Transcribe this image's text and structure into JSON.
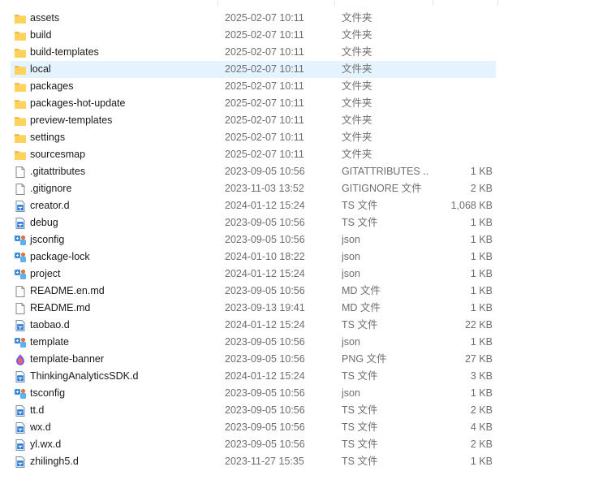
{
  "files": [
    {
      "name": "assets",
      "date": "2025-02-07 10:11",
      "type": "文件夹",
      "size": "",
      "icon": "folder-icon"
    },
    {
      "name": "build",
      "date": "2025-02-07 10:11",
      "type": "文件夹",
      "size": "",
      "icon": "folder-icon"
    },
    {
      "name": "build-templates",
      "date": "2025-02-07 10:11",
      "type": "文件夹",
      "size": "",
      "icon": "folder-icon"
    },
    {
      "name": "local",
      "date": "2025-02-07 10:11",
      "type": "文件夹",
      "size": "",
      "icon": "folder-icon",
      "selected": true
    },
    {
      "name": "packages",
      "date": "2025-02-07 10:11",
      "type": "文件夹",
      "size": "",
      "icon": "folder-icon"
    },
    {
      "name": "packages-hot-update",
      "date": "2025-02-07 10:11",
      "type": "文件夹",
      "size": "",
      "icon": "folder-icon"
    },
    {
      "name": "preview-templates",
      "date": "2025-02-07 10:11",
      "type": "文件夹",
      "size": "",
      "icon": "folder-icon"
    },
    {
      "name": "settings",
      "date": "2025-02-07 10:11",
      "type": "文件夹",
      "size": "",
      "icon": "folder-icon"
    },
    {
      "name": "sourcesmap",
      "date": "2025-02-07 10:11",
      "type": "文件夹",
      "size": "",
      "icon": "folder-icon"
    },
    {
      "name": ".gitattributes",
      "date": "2023-09-05 10:56",
      "type": "GITATTRIBUTES ...",
      "size": "1 KB",
      "icon": "blank-file-icon"
    },
    {
      "name": ".gitignore",
      "date": "2023-11-03 13:52",
      "type": "GITIGNORE 文件",
      "size": "2 KB",
      "icon": "blank-file-icon"
    },
    {
      "name": "creator.d",
      "date": "2024-01-12 15:24",
      "type": "TS 文件",
      "size": "1,068 KB",
      "icon": "ts-file-icon"
    },
    {
      "name": "debug",
      "date": "2023-09-05 10:56",
      "type": "TS 文件",
      "size": "1 KB",
      "icon": "ts-file-icon"
    },
    {
      "name": "jsconfig",
      "date": "2023-09-05 10:56",
      "type": "json",
      "size": "1 KB",
      "icon": "json-file-icon"
    },
    {
      "name": "package-lock",
      "date": "2024-01-10 18:22",
      "type": "json",
      "size": "1 KB",
      "icon": "json-file-icon"
    },
    {
      "name": "project",
      "date": "2024-01-12 15:24",
      "type": "json",
      "size": "1 KB",
      "icon": "json-file-icon"
    },
    {
      "name": "README.en.md",
      "date": "2023-09-05 10:56",
      "type": "MD 文件",
      "size": "1 KB",
      "icon": "blank-file-icon"
    },
    {
      "name": "README.md",
      "date": "2023-09-13 19:41",
      "type": "MD 文件",
      "size": "1 KB",
      "icon": "blank-file-icon"
    },
    {
      "name": "taobao.d",
      "date": "2024-01-12 15:24",
      "type": "TS 文件",
      "size": "22 KB",
      "icon": "ts-file-icon"
    },
    {
      "name": "template",
      "date": "2023-09-05 10:56",
      "type": "json",
      "size": "1 KB",
      "icon": "json-file-icon"
    },
    {
      "name": "template-banner",
      "date": "2023-09-05 10:56",
      "type": "PNG 文件",
      "size": "27 KB",
      "icon": "png-image-icon"
    },
    {
      "name": "ThinkingAnalyticsSDK.d",
      "date": "2024-01-12 15:24",
      "type": "TS 文件",
      "size": "3 KB",
      "icon": "ts-file-icon"
    },
    {
      "name": "tsconfig",
      "date": "2023-09-05 10:56",
      "type": "json",
      "size": "1 KB",
      "icon": "json-file-icon"
    },
    {
      "name": "tt.d",
      "date": "2023-09-05 10:56",
      "type": "TS 文件",
      "size": "2 KB",
      "icon": "ts-file-icon"
    },
    {
      "name": "wx.d",
      "date": "2023-09-05 10:56",
      "type": "TS 文件",
      "size": "4 KB",
      "icon": "ts-file-icon"
    },
    {
      "name": "yl.wx.d",
      "date": "2023-09-05 10:56",
      "type": "TS 文件",
      "size": "2 KB",
      "icon": "ts-file-icon"
    },
    {
      "name": "zhilingh5.d",
      "date": "2023-11-27 15:35",
      "type": "TS 文件",
      "size": "1 KB",
      "icon": "ts-file-icon"
    }
  ],
  "colors": {
    "folder": "#ffd25a",
    "selection": "#e5f3ff",
    "ts_badge": "#2b7bd6",
    "json_blue": "#3b8de0"
  }
}
